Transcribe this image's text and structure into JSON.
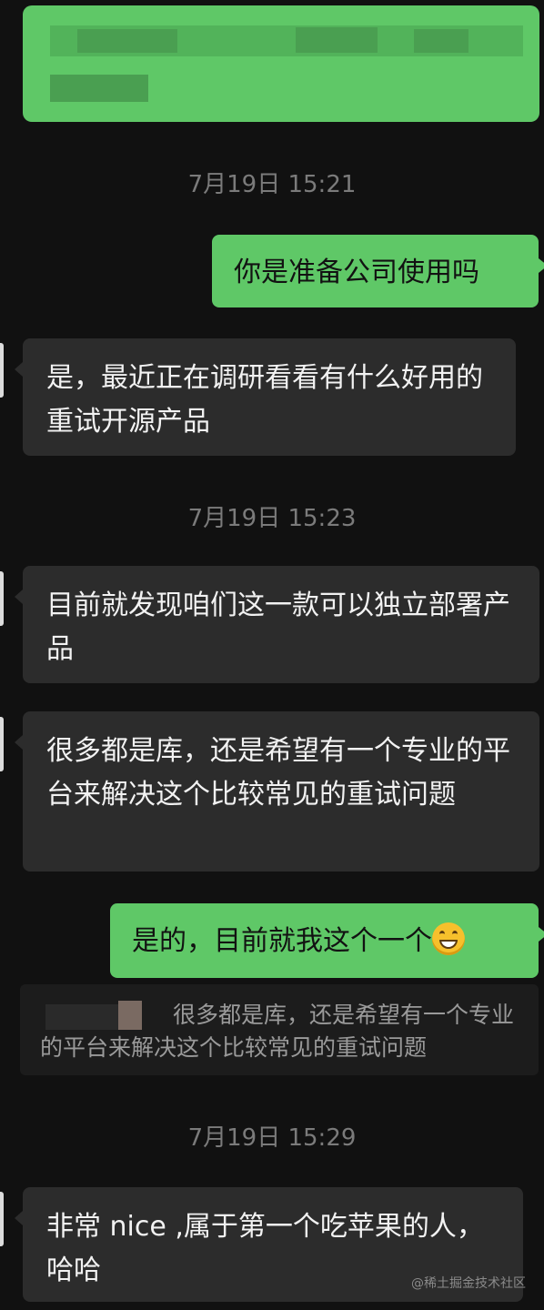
{
  "messages": {
    "m1": "你是准备公司使用吗",
    "m2": "是，最近正在调研看看有什么好用的重试开源产品",
    "m3": "目前就发现咱们这一款可以独立部署产品",
    "m4": "很多都是库，还是希望有一个专业的平台来解决这个比较常见的重试问题",
    "m5": "是的，目前就我这个一个",
    "m6": "非常 nice ,属于第一个吃苹果的人，哈哈"
  },
  "quote": {
    "text": "很多都是库，还是希望有一个专业的平台来解决这个比较常见的重试问题"
  },
  "times": {
    "t1": "7月19日 15:21",
    "t2": "7月19日 15:23",
    "t3": "7月19日 15:29"
  },
  "emoji": "grinning-face-icon",
  "watermark": "@稀土掘金技术社区",
  "colors": {
    "background": "#111111",
    "outgoing_bubble": "#5fc867",
    "incoming_bubble": "#2c2c2c",
    "timestamp": "#7b7b7b"
  }
}
